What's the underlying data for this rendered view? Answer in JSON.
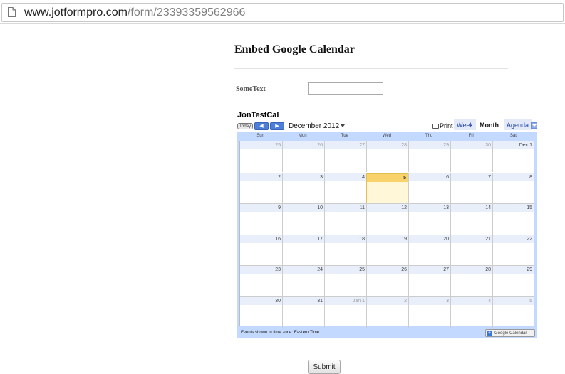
{
  "browser": {
    "url_host": "www.jotformpro.com",
    "url_path": "/form/23393359562966"
  },
  "form": {
    "title": "Embed Google Calendar",
    "field_label": "SomeText",
    "field_value": "",
    "submit_label": "Submit"
  },
  "calendar": {
    "title": "JonTestCal",
    "today_label": "Today",
    "prev_label": "◀",
    "next_label": "▶",
    "month_label": "December 2012",
    "print_label": "Print",
    "tabs": {
      "week": "Week",
      "month": "Month",
      "agenda": "Agenda"
    },
    "active_tab": "Month",
    "weekdays": [
      "Sun",
      "Mon",
      "Tue",
      "Wed",
      "Thu",
      "Fri",
      "Sat"
    ],
    "weeks": [
      [
        "25",
        "26",
        "27",
        "28",
        "29",
        "30",
        "Dec 1"
      ],
      [
        "2",
        "3",
        "4",
        "5",
        "6",
        "7",
        "8"
      ],
      [
        "9",
        "10",
        "11",
        "12",
        "13",
        "14",
        "15"
      ],
      [
        "16",
        "17",
        "18",
        "19",
        "20",
        "21",
        "22"
      ],
      [
        "23",
        "24",
        "25",
        "26",
        "27",
        "28",
        "29"
      ],
      [
        "30",
        "31",
        "Jan 1",
        "2",
        "3",
        "4",
        "5"
      ]
    ],
    "other_month_days": [
      [
        0,
        0
      ],
      [
        0,
        1
      ],
      [
        0,
        2
      ],
      [
        0,
        3
      ],
      [
        0,
        4
      ],
      [
        0,
        5
      ],
      [
        5,
        2
      ],
      [
        5,
        3
      ],
      [
        5,
        4
      ],
      [
        5,
        5
      ],
      [
        5,
        6
      ]
    ],
    "today": "5",
    "timezone_note": "Events shown in time zone: Eastern Time",
    "badge_text": "Google Calendar",
    "colors": {
      "header_blue": "#c3d9ff",
      "today_highlight": "#f8d36b",
      "nav_blue": "#4d7fd9"
    }
  }
}
